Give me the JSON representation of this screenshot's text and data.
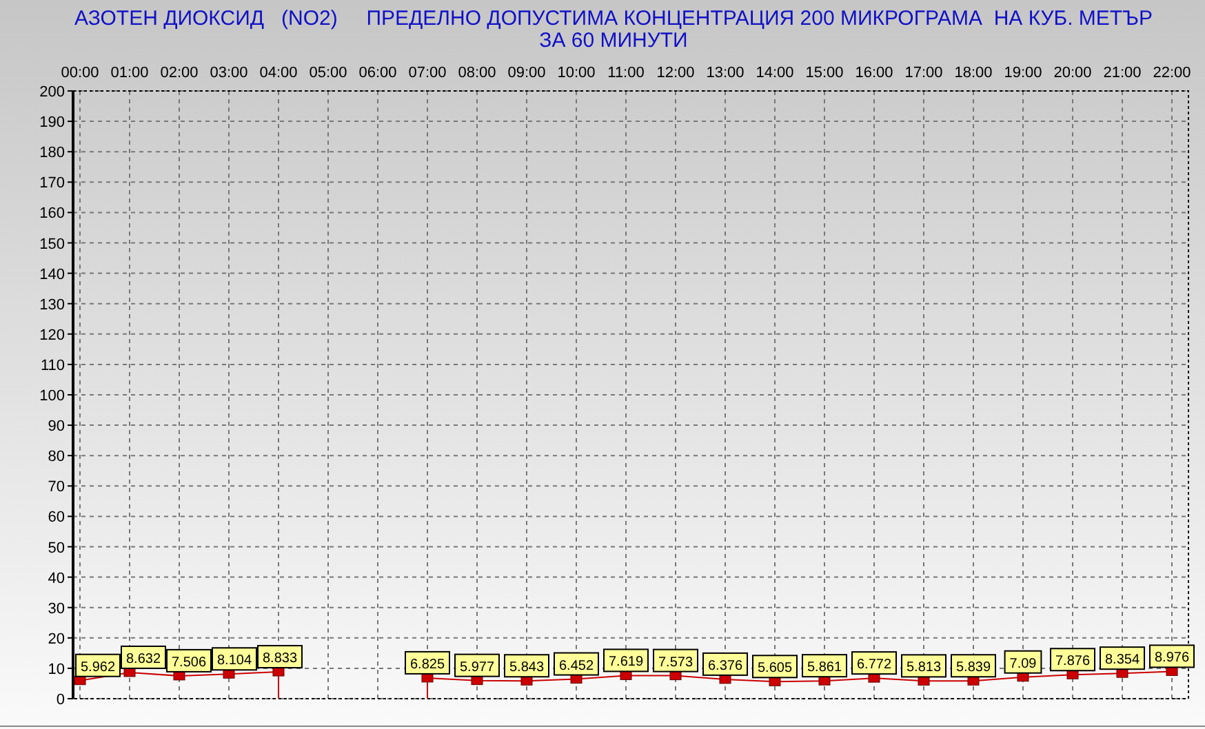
{
  "chart": {
    "title_lines": [
      "АЗОТЕН ДИОКСИД   (NO2)     ПРЕДЕЛНО ДОПУСТИМА КОНЦЕНТРАЦИЯ 200 МИКРОГРАМА  НА КУБ. МЕТЪР",
      "ЗА 60 МИНУТИ"
    ],
    "chart_data": {
      "type": "line",
      "grid": true,
      "categories": [
        "00:00",
        "01:00",
        "02:00",
        "03:00",
        "04:00",
        "05:00",
        "06:00",
        "07:00",
        "08:00",
        "09:00",
        "10:00",
        "11:00",
        "12:00",
        "13:00",
        "14:00",
        "15:00",
        "16:00",
        "17:00",
        "18:00",
        "19:00",
        "20:00",
        "21:00",
        "22:00"
      ],
      "series": [
        {
          "color": "#cc0000",
          "marker": "square",
          "values": [
            5.962,
            8.632,
            7.506,
            8.104,
            8.833,
            null,
            null,
            6.825,
            5.977,
            5.843,
            6.452,
            7.619,
            7.573,
            6.376,
            5.605,
            5.861,
            6.772,
            5.813,
            5.839,
            7.09,
            7.876,
            8.354,
            8.976
          ]
        }
      ],
      "value_labels": [
        "5.962",
        "8.632",
        "7.506",
        "8.104",
        "8.833",
        null,
        null,
        "6.825",
        "5.977",
        "5.843",
        "6.452",
        "7.619",
        "7.573",
        "6.376",
        "5.605",
        "5.861",
        "6.772",
        "5.813",
        "5.839",
        "7.09",
        "7.876",
        "8.354",
        "8.976"
      ],
      "ylim": [
        0,
        200
      ],
      "yticks": [
        0,
        10,
        20,
        30,
        40,
        50,
        60,
        70,
        80,
        90,
        100,
        110,
        120,
        130,
        140,
        150,
        160,
        170,
        180,
        190,
        200
      ],
      "data_labels": true
    }
  }
}
